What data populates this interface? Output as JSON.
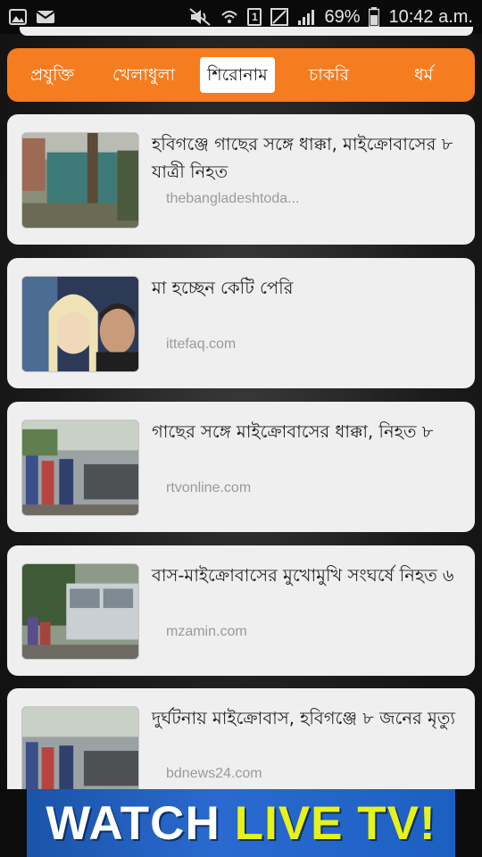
{
  "status_bar": {
    "battery": "69%",
    "time": "10:42 a.m.",
    "sim_slot": "1"
  },
  "tabs": [
    {
      "label": "প্রযুক্তি",
      "active": false
    },
    {
      "label": "খেলাধুলা",
      "active": false
    },
    {
      "label": "শিরোনাম",
      "active": true
    },
    {
      "label": "চাকরি",
      "active": false
    },
    {
      "label": "ধর্ম",
      "active": false
    }
  ],
  "news": [
    {
      "title": "হবিগঞ্জে গাছের সঙ্গে ধাক্কা, মাইক্রোবাসের ৮ যাত্রী নিহত",
      "source": "thebangladeshtoda...",
      "thumb": "crashed-van-tree-photo"
    },
    {
      "title": "মা হচ্ছেন কেটি পেরি",
      "source": "ittefaq.com",
      "thumb": "couple-portrait-photo"
    },
    {
      "title": "গাছের সঙ্গে মাইক্রোবাসের ধাক্কা, নিহত ৮",
      "source": "rtvonline.com",
      "thumb": "crowd-wreck-photo"
    },
    {
      "title": "বাস-মাইক্রোবাসের মুখোমুখি সংঘর্ষে নিহত ৬",
      "source": "mzamin.com",
      "thumb": "bus-street-photo"
    },
    {
      "title": "দুর্ঘটনায় মাইক্রোবাস, হবিগঞ্জে ৮ জনের মৃত্যু",
      "source": "bdnews24.com",
      "thumb": "crowd-wreck-photo"
    }
  ],
  "ad": {
    "word1": "WATCH",
    "word2": "LIVE TV!"
  },
  "colors": {
    "tab_bar": "#f57c1f",
    "card_bg": "#efefef",
    "ad_blue": "#1f5fc2",
    "ad_yellow": "#e6f21a"
  }
}
